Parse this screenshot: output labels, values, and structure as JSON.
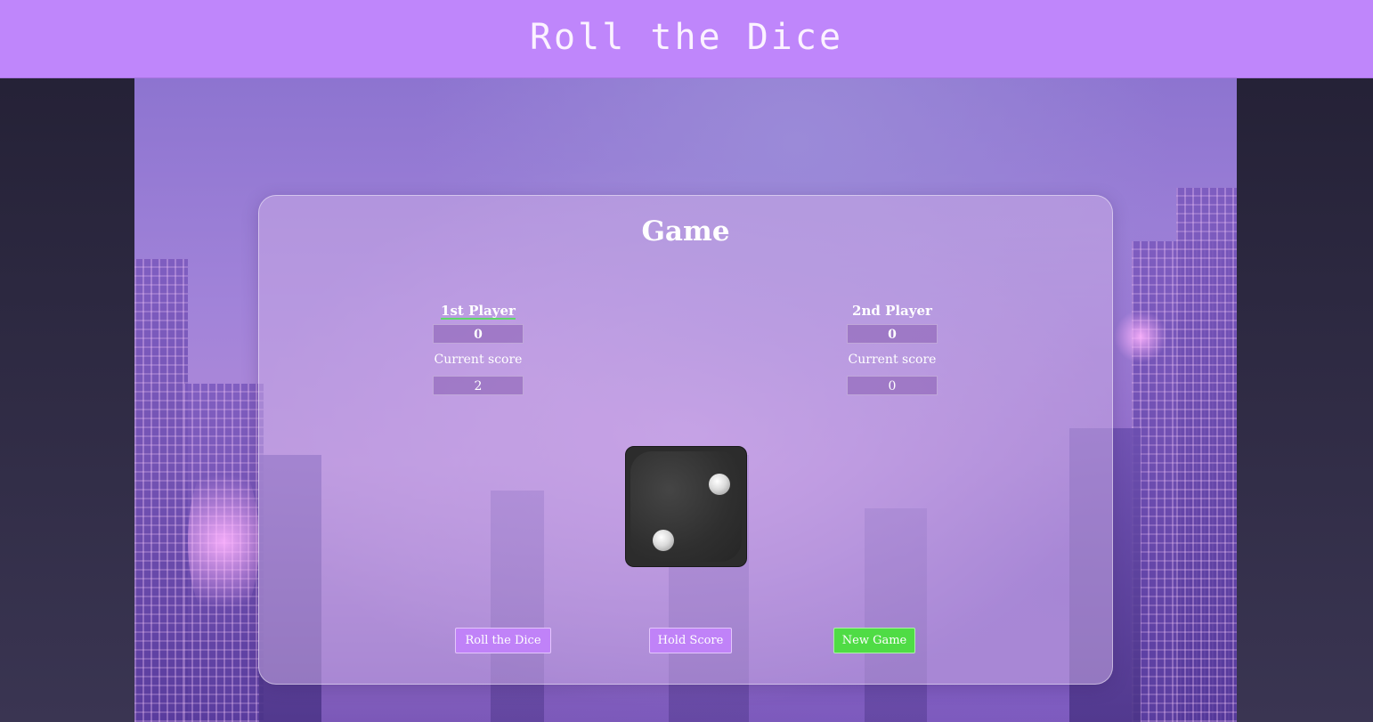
{
  "header": {
    "title": "Roll the Dice"
  },
  "game": {
    "title": "Game",
    "players": [
      {
        "name": "1st Player",
        "score": "0",
        "current_label": "Current score",
        "current_score": "2",
        "active": true
      },
      {
        "name": "2nd Player",
        "score": "0",
        "current_label": "Current score",
        "current_score": "0",
        "active": false
      }
    ],
    "dice": {
      "value": 2,
      "icon": "dice-two-icon"
    },
    "buttons": {
      "roll_label": "Roll the Dice",
      "hold_label": "Hold Score",
      "new_label": "New Game"
    }
  },
  "colors": {
    "header_bg": "#bf86fb",
    "button_purple": "#c082f8",
    "button_green": "#4fdc45",
    "active_underline": "#5fd86a"
  }
}
